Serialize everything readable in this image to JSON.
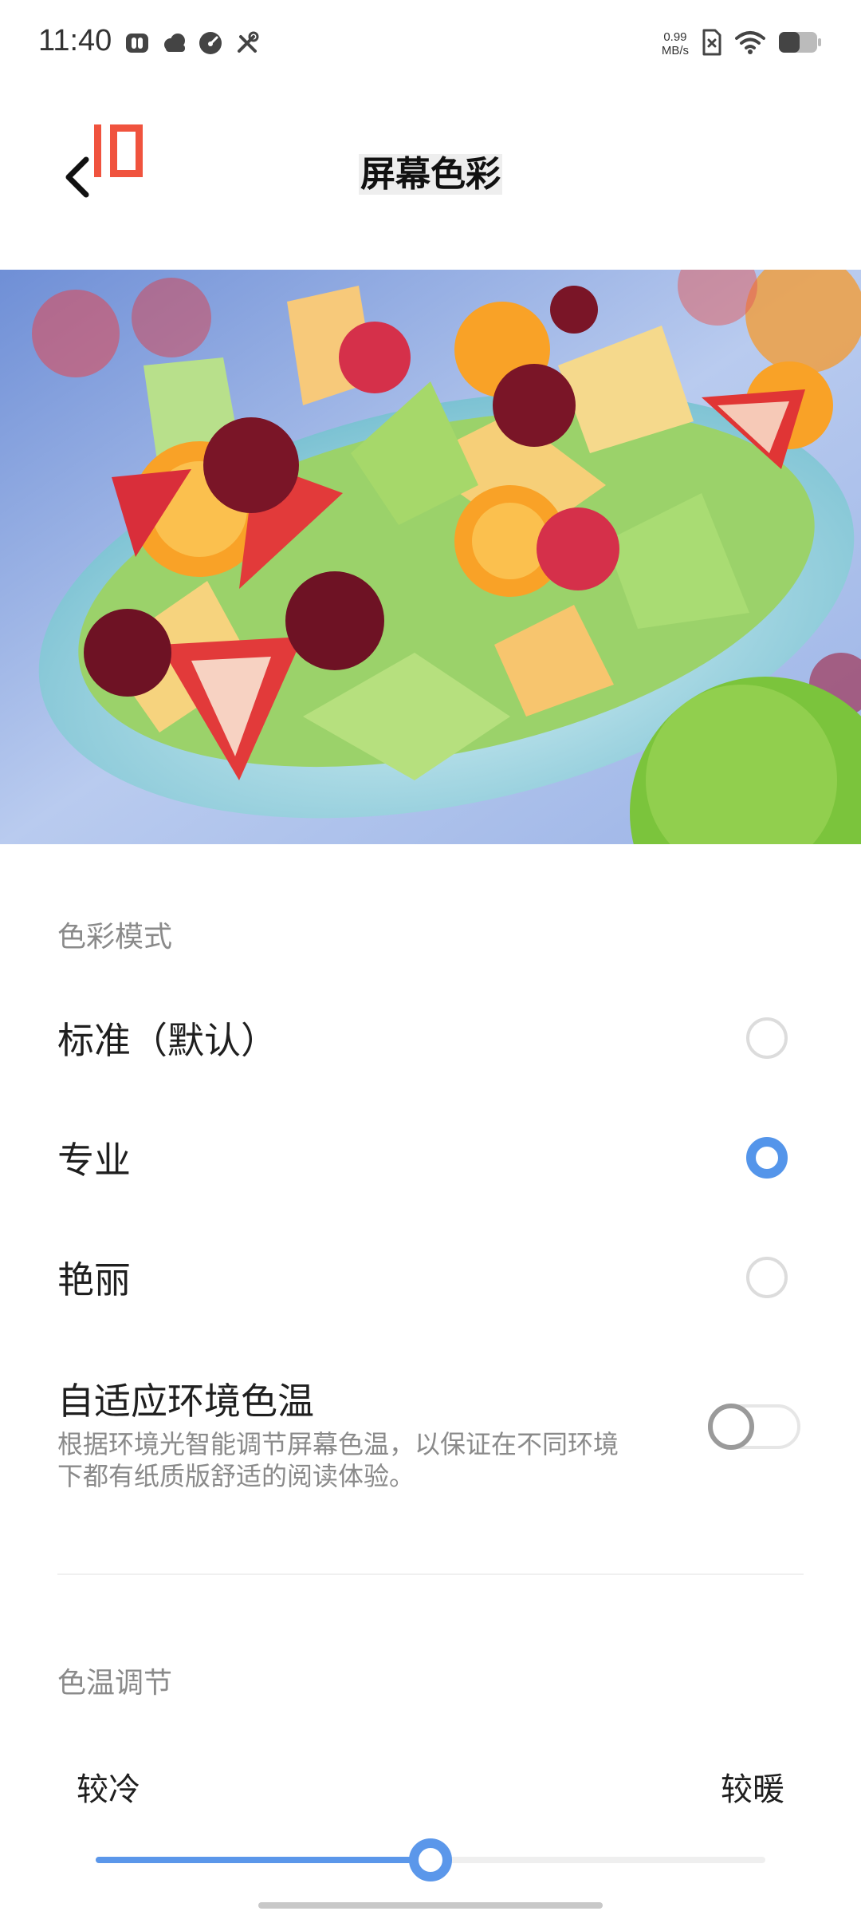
{
  "status_bar": {
    "time": "11:40",
    "net_speed_value": "0.99",
    "net_speed_unit": "MB/s",
    "left_icons": [
      "vpn-icon",
      "cloud-icon",
      "speed-gauge-icon",
      "tools-icon"
    ],
    "right_icons": [
      "sim-error-icon",
      "wifi-icon",
      "battery-icon"
    ]
  },
  "header": {
    "title": "屏幕色彩",
    "logo_text": "IO"
  },
  "color_mode": {
    "section_label": "色彩模式",
    "options": [
      {
        "label": "标准（默认）",
        "selected": false
      },
      {
        "label": "专业",
        "selected": true
      },
      {
        "label": "艳丽",
        "selected": false
      }
    ]
  },
  "adaptive": {
    "title": "自适应环境色温",
    "description": "根据环境光智能调节屏幕色温，以保证在不同环境下都有纸质版舒适的阅读体验。",
    "enabled": false
  },
  "temperature": {
    "section_label": "色温调节",
    "cool_label": "较冷",
    "warm_label": "较暖",
    "level": 0.5
  },
  "colors": {
    "accent": "#5495ea",
    "logo": "#f0533e",
    "secondary_text": "#8a8a8a"
  }
}
